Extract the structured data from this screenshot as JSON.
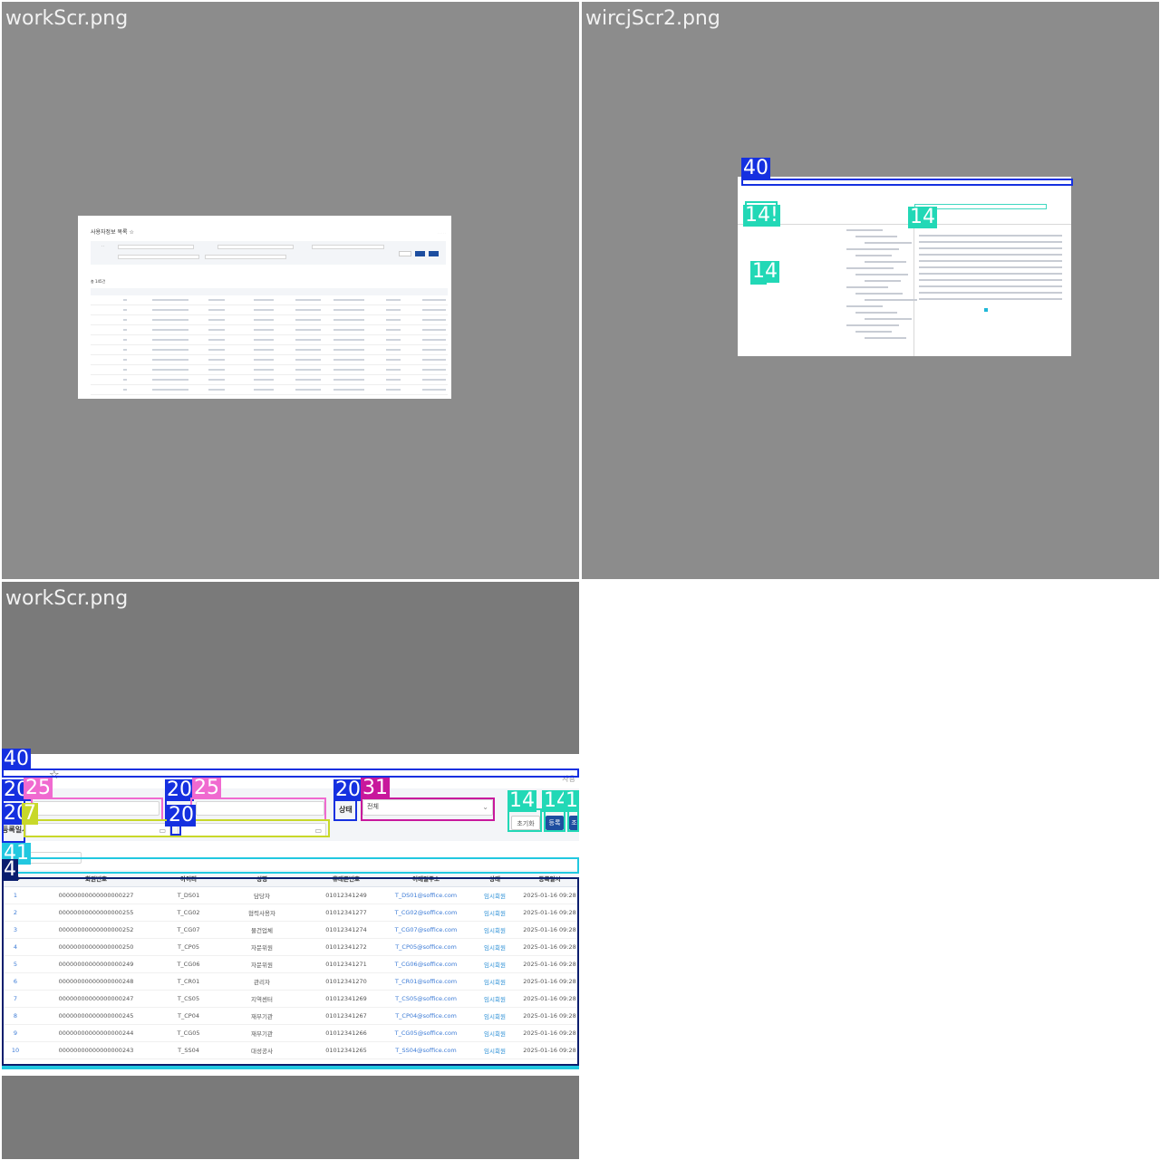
{
  "panels": {
    "p1_title": "workScr.png",
    "p2_title": "wircjScr2.png",
    "p3_title": "workScr.png"
  },
  "mini": {
    "title": "사용자정보 목록 ☆",
    "count": "총 145건"
  },
  "annotations": {
    "p2": [
      "40",
      "14",
      "14!",
      "14",
      "14"
    ],
    "p3": [
      "40",
      "20",
      "25",
      "20",
      "25",
      "20",
      "31",
      "20",
      "7",
      "20",
      "14",
      "14",
      "14",
      "41",
      "4"
    ]
  },
  "page": {
    "star": "☆",
    "breadcrumb": "사용",
    "filter": {
      "status_label": "상태",
      "status_value": "전체",
      "date_label": "등록일시",
      "reset_label": "초기화",
      "register_label": "등록",
      "search_label": "조"
    },
    "page_size": "10",
    "table": {
      "headers": [
        "No",
        "회원번호",
        "아이디",
        "성명",
        "휴대폰번호",
        "이메일주소",
        "상태",
        "등록일시"
      ],
      "rows": [
        [
          "1",
          "00000000000000000227",
          "T_DS01",
          "담당자",
          "01012341249",
          "T_DS01@soffice.com",
          "임시회원",
          "2025-01-16 09:28"
        ],
        [
          "2",
          "00000000000000000255",
          "T_CG02",
          "협력사용자",
          "01012341277",
          "T_CG02@soffice.com",
          "임시회원",
          "2025-01-16 09:28"
        ],
        [
          "3",
          "00000000000000000252",
          "T_CG07",
          "물건업체",
          "01012341274",
          "T_CG07@soffice.com",
          "임시회원",
          "2025-01-16 09:28"
        ],
        [
          "4",
          "00000000000000000250",
          "T_CP05",
          "자문위원",
          "01012341272",
          "T_CP05@soffice.com",
          "임시회원",
          "2025-01-16 09:28"
        ],
        [
          "5",
          "00000000000000000249",
          "T_CG06",
          "자문위원",
          "01012341271",
          "T_CG06@soffice.com",
          "임시회원",
          "2025-01-16 09:28"
        ],
        [
          "6",
          "00000000000000000248",
          "T_CR01",
          "관리자",
          "01012341270",
          "T_CR01@soffice.com",
          "임시회원",
          "2025-01-16 09:28"
        ],
        [
          "7",
          "00000000000000000247",
          "T_CS05",
          "지역센터",
          "01012341269",
          "T_CS05@soffice.com",
          "임시회원",
          "2025-01-16 09:28"
        ],
        [
          "8",
          "00000000000000000245",
          "T_CP04",
          "재부기관",
          "01012341267",
          "T_CP04@soffice.com",
          "임시회원",
          "2025-01-16 09:28"
        ],
        [
          "9",
          "00000000000000000244",
          "T_CG05",
          "재부기관",
          "01012341266",
          "T_CG05@soffice.com",
          "임시회원",
          "2025-01-16 09:28"
        ],
        [
          "10",
          "00000000000000000243",
          "T_SS04",
          "대성공사",
          "01012341265",
          "T_SS04@soffice.com",
          "임시회원",
          "2025-01-16 09:28"
        ]
      ]
    }
  },
  "colors": {
    "ann_blue": "#1530e0",
    "ann_navy": "#0a1e6e",
    "ann_pink": "#f06ad0",
    "ann_magenta": "#c8189c",
    "ann_lime": "#c8d82a",
    "ann_teal": "#22d8b6",
    "ann_cyan": "#22c8e0",
    "primary_button": "#1d4ea0"
  }
}
